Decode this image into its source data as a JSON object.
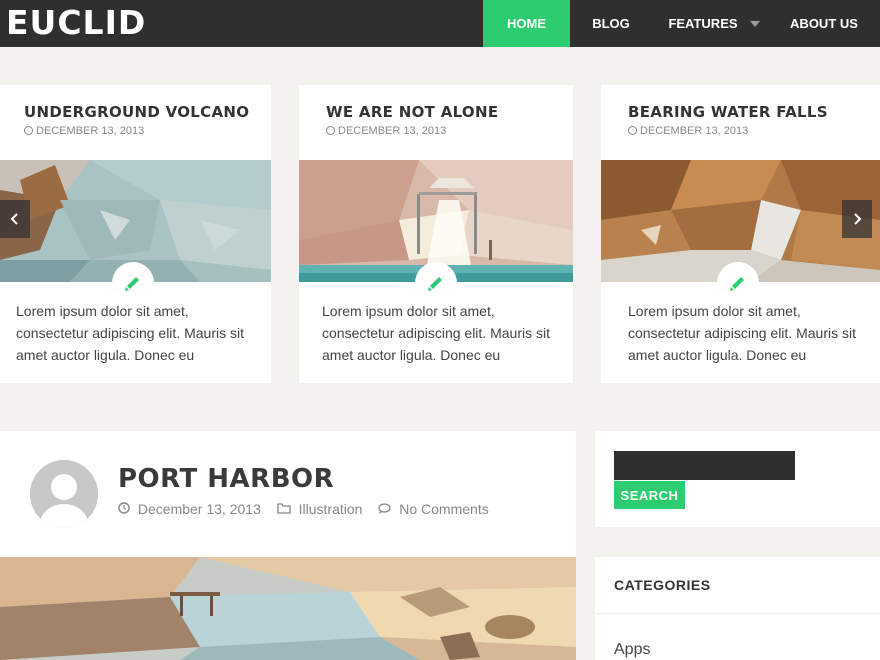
{
  "header": {
    "logo": "EUCLID",
    "nav": [
      {
        "label": "HOME"
      },
      {
        "label": "BLOG"
      },
      {
        "label": "FEATURES"
      },
      {
        "label": "ABOUT US"
      }
    ],
    "active_color": "#2ecc71",
    "bg_color": "#2f2f2f"
  },
  "slider": {
    "cards": [
      {
        "title": "UNDERGROUND VOLCANO",
        "date": "DECEMBER 13, 2013",
        "excerpt": "Lorem ipsum dolor sit amet, consectetur adipiscing elit. Mauris sit amet auctor ligula. Donec eu",
        "icon": "pencil-icon"
      },
      {
        "title": "WE ARE NOT ALONE",
        "date": "DECEMBER 13, 2013",
        "excerpt": "Lorem ipsum dolor sit amet, consectetur adipiscing elit. Mauris sit amet auctor ligula. Donec eu",
        "icon": "pencil-icon"
      },
      {
        "title": "BEARING WATER FALLS",
        "date": "DECEMBER 13, 2013",
        "excerpt": "Lorem ipsum dolor sit amet, consectetur adipiscing elit. Mauris sit amet auctor ligula. Donec eu",
        "icon": "pencil-icon"
      }
    ],
    "prev_icon": "chevron-left-icon",
    "next_icon": "chevron-right-icon"
  },
  "post": {
    "title": "PORT HARBOR",
    "date": "December 13, 2013",
    "category": "Illustration",
    "comments": "No Comments"
  },
  "sidebar": {
    "search": {
      "value": "",
      "placeholder": "",
      "button_label": "SEARCH"
    },
    "categories": {
      "title": "CATEGORIES",
      "items": [
        "Apps"
      ]
    }
  }
}
